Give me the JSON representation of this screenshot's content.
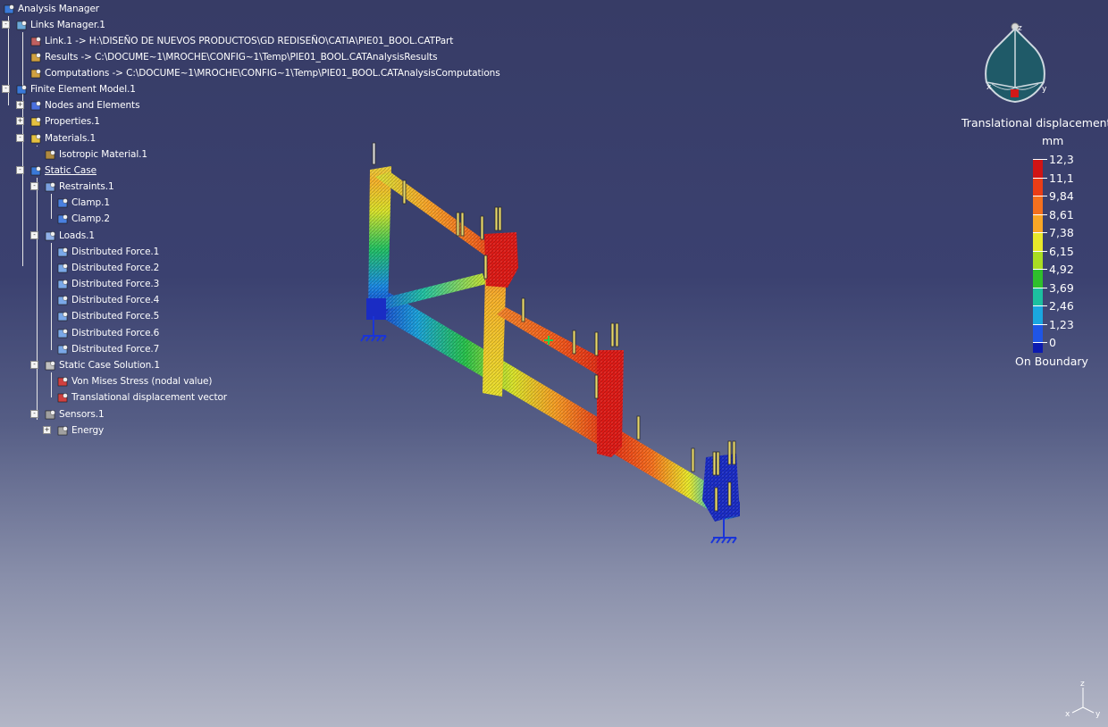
{
  "tree": {
    "nodes": [
      {
        "label": "Analysis Manager",
        "icon": "analysis-manager-icon"
      },
      {
        "label": "Links Manager.1",
        "icon": "links-manager-icon"
      },
      {
        "label": "Link.1 -> H:\\DISEÑO DE NUEVOS PRODUCTOS\\GD REDISEÑO\\CATIA\\PIE01_BOOL.CATPart",
        "icon": "link-icon"
      },
      {
        "label": "Results -> C:\\DOCUME~1\\MROCHE\\CONFIG~1\\Temp\\PIE01_BOOL.CATAnalysisResults",
        "icon": "results-link-icon"
      },
      {
        "label": "Computations -> C:\\DOCUME~1\\MROCHE\\CONFIG~1\\Temp\\PIE01_BOOL.CATAnalysisComputations",
        "icon": "computations-link-icon"
      },
      {
        "label": "Finite Element Model.1",
        "icon": "finite-element-model-icon"
      },
      {
        "label": "Nodes and Elements",
        "icon": "nodes-elements-icon"
      },
      {
        "label": "Properties.1",
        "icon": "properties-folder-icon"
      },
      {
        "label": "Materials.1",
        "icon": "materials-folder-icon"
      },
      {
        "label": "Isotropic Material.1",
        "icon": "material-icon"
      },
      {
        "label": "Static Case",
        "icon": "static-case-icon"
      },
      {
        "label": "Restraints.1",
        "icon": "restraints-icon"
      },
      {
        "label": "Clamp.1",
        "icon": "clamp-icon"
      },
      {
        "label": "Clamp.2",
        "icon": "clamp-icon"
      },
      {
        "label": "Loads.1",
        "icon": "loads-icon"
      },
      {
        "label": "Distributed Force.1",
        "icon": "distributed-force-icon"
      },
      {
        "label": "Distributed Force.2",
        "icon": "distributed-force-icon"
      },
      {
        "label": "Distributed Force.3",
        "icon": "distributed-force-icon"
      },
      {
        "label": "Distributed Force.4",
        "icon": "distributed-force-icon"
      },
      {
        "label": "Distributed Force.5",
        "icon": "distributed-force-icon"
      },
      {
        "label": "Distributed Force.6",
        "icon": "distributed-force-icon"
      },
      {
        "label": "Distributed Force.7",
        "icon": "distributed-force-icon"
      },
      {
        "label": "Static Case Solution.1",
        "icon": "solution-icon"
      },
      {
        "label": "Von Mises Stress (nodal value)",
        "icon": "von-mises-image-icon"
      },
      {
        "label": "Translational displacement vector",
        "icon": "displacement-image-icon"
      },
      {
        "label": "Sensors.1",
        "icon": "sensors-icon"
      },
      {
        "label": "Energy",
        "icon": "energy-sensor-icon"
      }
    ]
  },
  "legend": {
    "title": "Translational displacement v",
    "unit": "mm",
    "values": [
      "12,3",
      "11,1",
      "9,84",
      "8,61",
      "7,38",
      "6,15",
      "4,92",
      "3,69",
      "2,46",
      "1,23",
      "0"
    ],
    "colors": [
      "#d01414",
      "#ea3d16",
      "#f4701e",
      "#f9a626",
      "#e8e82a",
      "#a9dd22",
      "#2fbf2c",
      "#1cc0a0",
      "#1aa7e0",
      "#1f55e6",
      "#0c1ab0"
    ],
    "footer": "On Boundary"
  },
  "compass": {
    "axes": [
      "z",
      "x",
      "y"
    ]
  },
  "axis_triad": {
    "labels": [
      "z",
      "x",
      "y"
    ]
  }
}
